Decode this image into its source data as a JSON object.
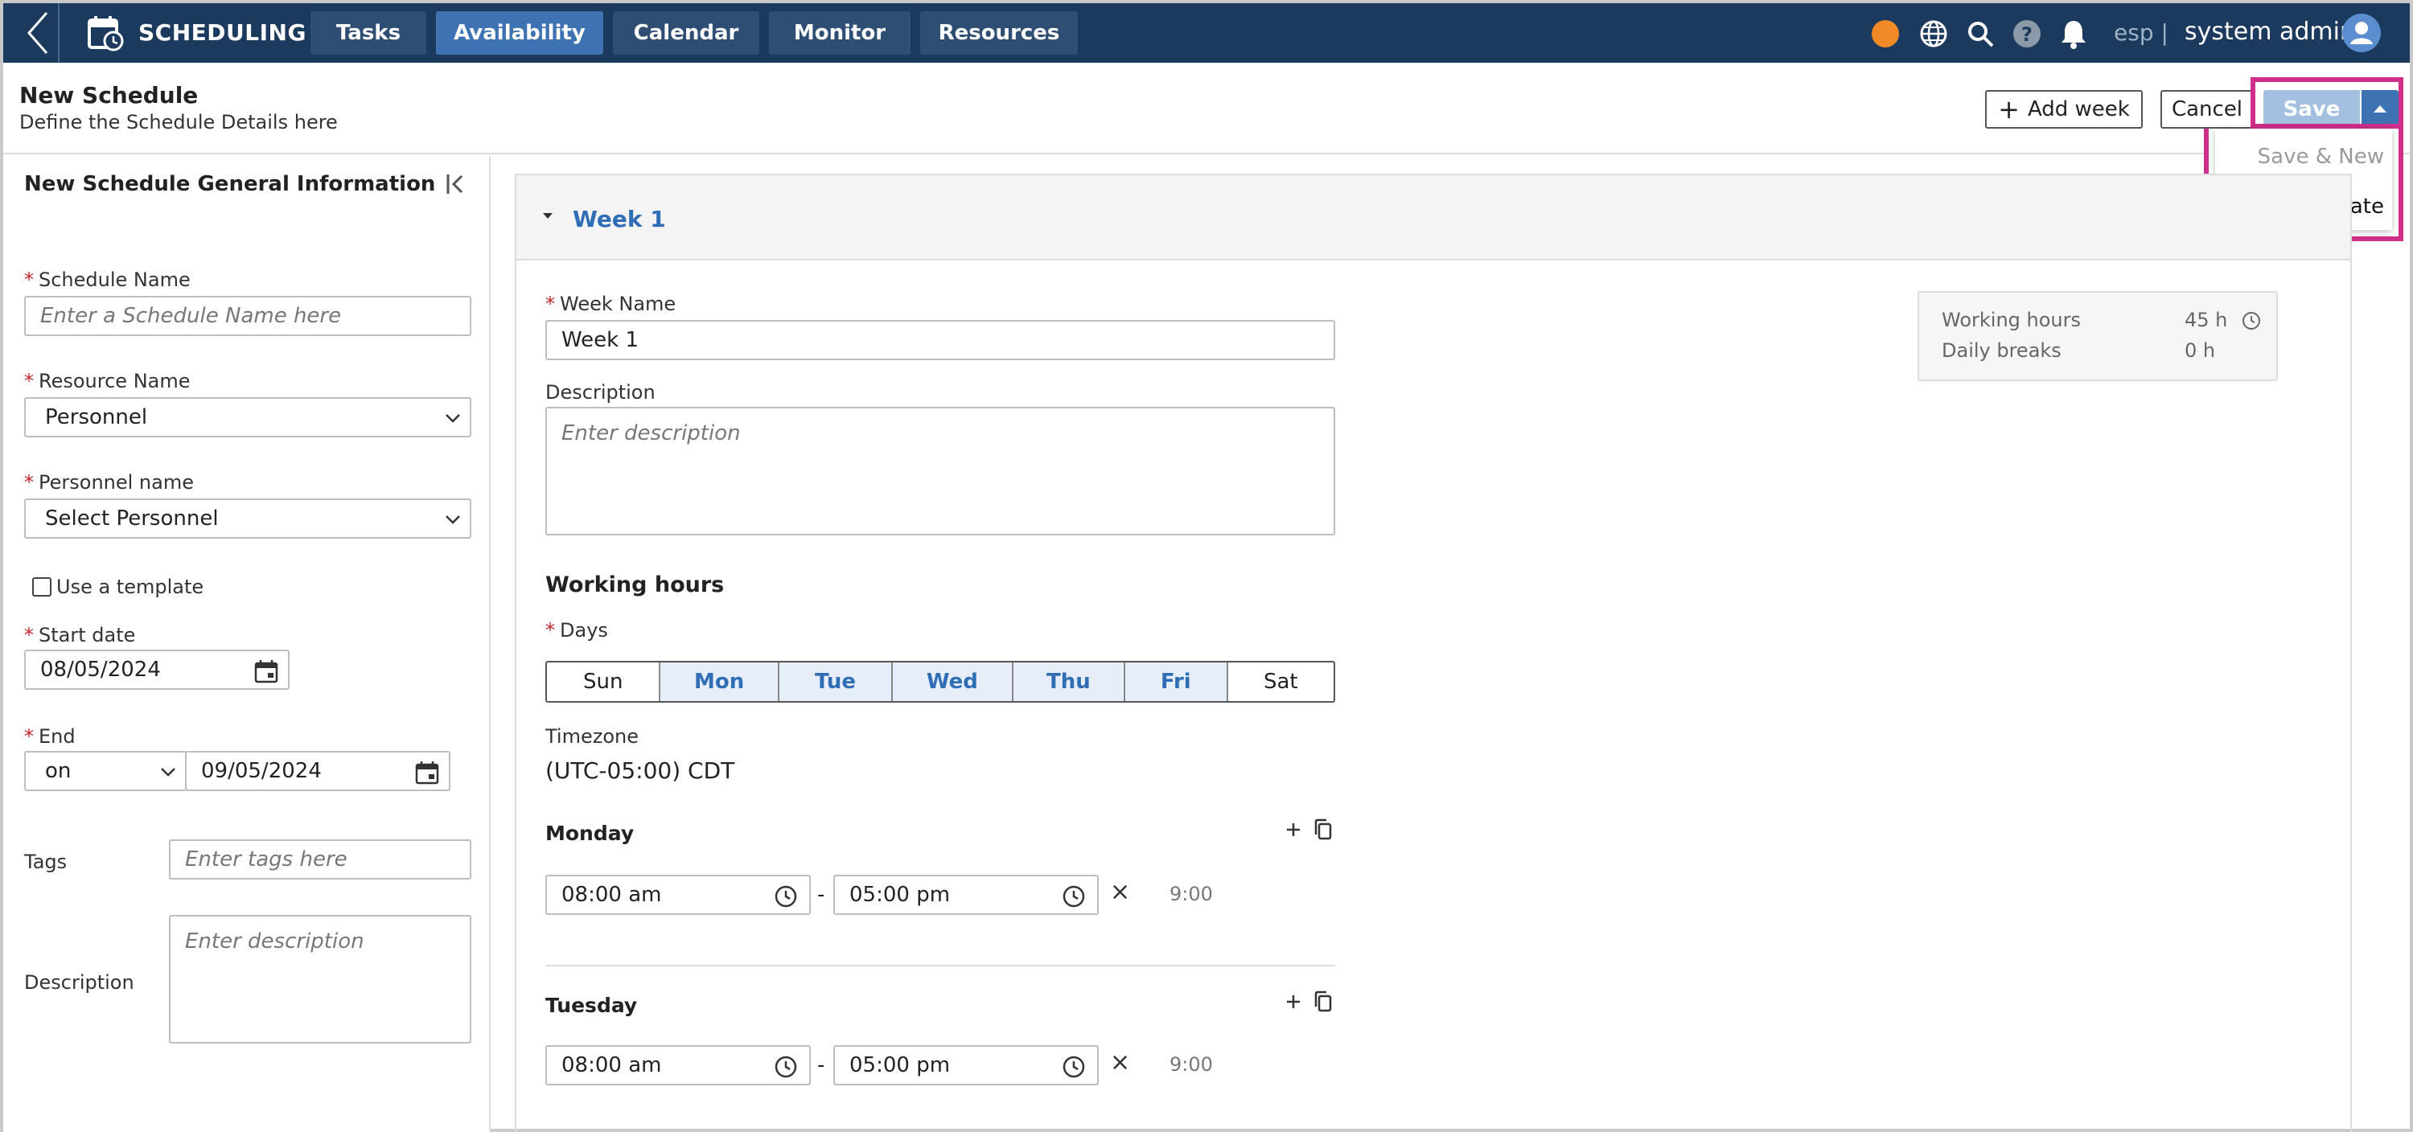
{
  "topbar": {
    "app_title": "SCHEDULING",
    "tabs": [
      {
        "label": "Tasks",
        "active": false
      },
      {
        "label": "Availability",
        "active": true
      },
      {
        "label": "Calendar",
        "active": false
      },
      {
        "label": "Monitor",
        "active": false
      },
      {
        "label": "Resources",
        "active": false
      }
    ],
    "icons": [
      "status-dot-icon",
      "globe-icon",
      "search-icon",
      "help-icon",
      "bell-icon"
    ],
    "language": "esp |",
    "user_name": "system admin",
    "status_color": "#f08a24"
  },
  "header": {
    "title": "New Schedule",
    "subtitle": "Define the Schedule Details here",
    "add_week_label": "Add week",
    "cancel_label": "Cancel",
    "save_label": "Save",
    "save_menu": {
      "save_new": "Save & New",
      "save_template": "Save as Template"
    },
    "highlight_color": "#cf2e8a"
  },
  "general": {
    "title": "New Schedule General Information",
    "schedule_name": {
      "label": "Schedule Name",
      "placeholder": "Enter a Schedule Name here"
    },
    "resource_name": {
      "label": "Resource Name",
      "value": "Personnel"
    },
    "personnel_name": {
      "label": "Personnel name",
      "value": "Select Personnel"
    },
    "use_template": {
      "label": "Use a template",
      "checked": false
    },
    "start_date": {
      "label": "Start date",
      "value": "08/05/2024"
    },
    "end": {
      "label": "End",
      "mode": "on",
      "value": "09/05/2024"
    },
    "tags": {
      "label": "Tags",
      "placeholder": "Enter tags here"
    },
    "description": {
      "label": "Description",
      "placeholder": "Enter description"
    }
  },
  "week": {
    "title": "Week 1",
    "name_label": "Week Name",
    "name_value": "Week 1",
    "description_label": "Description",
    "description_placeholder": "Enter description",
    "summary": {
      "working_hours_label": "Working hours",
      "working_hours_value": "45 h",
      "daily_breaks_label": "Daily breaks",
      "daily_breaks_value": "0 h"
    },
    "working_hours_heading": "Working hours",
    "days_label": "Days",
    "days": [
      {
        "label": "Sun",
        "selected": false
      },
      {
        "label": "Mon",
        "selected": true
      },
      {
        "label": "Tue",
        "selected": true
      },
      {
        "label": "Wed",
        "selected": true
      },
      {
        "label": "Thu",
        "selected": true
      },
      {
        "label": "Fri",
        "selected": true
      },
      {
        "label": "Sat",
        "selected": false
      }
    ],
    "timezone_label": "Timezone",
    "timezone_value": "(UTC-05:00) CDT",
    "schedule": [
      {
        "day": "Monday",
        "start": "08:00 am",
        "end": "05:00 pm",
        "duration": "9:00"
      },
      {
        "day": "Tuesday",
        "start": "08:00 am",
        "end": "05:00 pm",
        "duration": "9:00"
      }
    ],
    "range_separator": "-",
    "remove_symbol": "×"
  }
}
